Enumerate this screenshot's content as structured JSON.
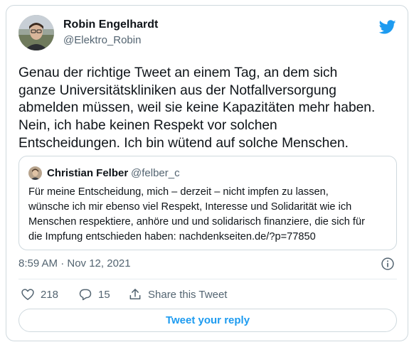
{
  "tweet": {
    "author_name": "Robin Engelhardt",
    "author_handle": "@Elektro_Robin",
    "text": "Genau der richtige Tweet an einem Tag, an dem sich\nganze Universitätskliniken aus der Notfallversorgung\nabmelden müssen, weil sie keine Kapazitäten mehr haben.\nNein, ich habe keinen Respekt vor solchen\nEntscheidungen. Ich bin wütend auf solche Menschen.",
    "timestamp": "8:59 AM · Nov 12, 2021"
  },
  "quoted_tweet": {
    "author_name": "Christian Felber",
    "author_handle": "@felber_c",
    "text": "Für meine Entscheidung, mich  – derzeit – nicht impfen zu lassen,\nwünsche ich mir ebenso viel Respekt, Interesse und Solidarität wie ich\nMenschen respektiere, anhöre und und solidarisch finanziere, die sich für\ndie Impfung entschieden haben: nachdenkseiten.de/?p=77850"
  },
  "actions": {
    "likes": "218",
    "replies": "15",
    "share_label": "Share this Tweet"
  },
  "reply_button_label": "Tweet your reply",
  "icons": {
    "brand": "twitter-bird-icon",
    "info": "info-icon",
    "like": "heart-icon",
    "reply": "reply-bubble-icon",
    "share": "share-upload-icon"
  },
  "colors": {
    "accent": "#1d9bf0",
    "text": "#0f1419",
    "secondary": "#536471",
    "border": "#cfd9de"
  }
}
